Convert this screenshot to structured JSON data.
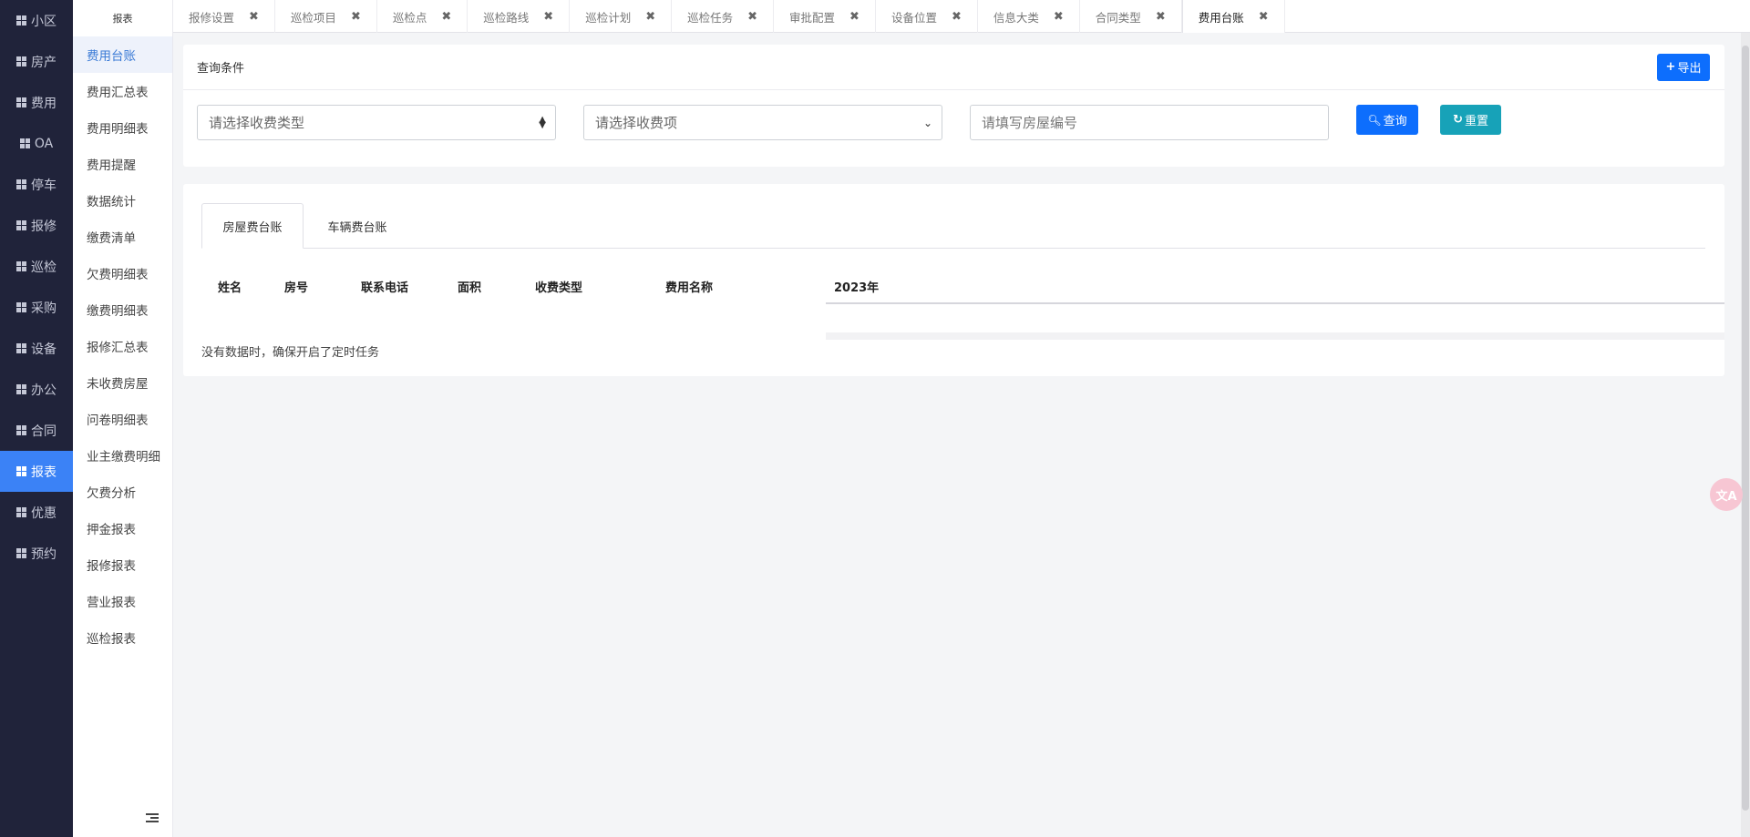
{
  "nav": {
    "items": [
      {
        "label": "小区",
        "icon": "grid-icon"
      },
      {
        "label": "房产",
        "icon": "grid-icon"
      },
      {
        "label": "费用",
        "icon": "grid-icon"
      },
      {
        "label": "OA",
        "icon": "grid-icon"
      },
      {
        "label": "停车",
        "icon": "grid-icon"
      },
      {
        "label": "报修",
        "icon": "grid-icon"
      },
      {
        "label": "巡检",
        "icon": "grid-icon"
      },
      {
        "label": "采购",
        "icon": "grid-icon"
      },
      {
        "label": "设备",
        "icon": "grid-icon"
      },
      {
        "label": "办公",
        "icon": "grid-icon"
      },
      {
        "label": "合同",
        "icon": "grid-icon"
      },
      {
        "label": "报表",
        "icon": "grid-icon"
      },
      {
        "label": "优惠",
        "icon": "grid-icon"
      },
      {
        "label": "预约",
        "icon": "grid-icon"
      }
    ],
    "active_index": 11,
    "active_color": "#3b82f6"
  },
  "subnav": {
    "title": "报表",
    "items": [
      "费用台账",
      "费用汇总表",
      "费用明细表",
      "费用提醒",
      "数据统计",
      "缴费清单",
      "欠费明细表",
      "缴费明细表",
      "报修汇总表",
      "未收费房屋",
      "问卷明细表",
      "业主缴费明细",
      "欠费分析",
      "押金报表",
      "报修报表",
      "营业报表",
      "巡检报表"
    ],
    "active_index": 0,
    "collapse_icon": "collapse-menu-icon"
  },
  "tabs": {
    "items": [
      "报修设置",
      "巡检项目",
      "巡检点",
      "巡检路线",
      "巡检计划",
      "巡检任务",
      "审批配置",
      "设备位置",
      "信息大类",
      "合同类型",
      "费用台账"
    ],
    "active_index": 10,
    "close_glyph": "✖"
  },
  "query": {
    "title": "查询条件",
    "export_label": "导出",
    "fee_type_placeholder": "请选择收费类型",
    "fee_item_placeholder": "请选择收费项",
    "house_no_placeholder": "请填写房屋编号",
    "search_label": "查询",
    "reset_label": "重置"
  },
  "ledger": {
    "tabs": [
      "房屋费台账",
      "车辆费台账"
    ],
    "active_tab": 0,
    "columns": [
      "姓名",
      "房号",
      "联系电话",
      "面积",
      "收费类型",
      "费用名称",
      "2023年"
    ],
    "rows": [],
    "empty_note": "没有数据时，确保开启了定时任务"
  },
  "colors": {
    "primary": "#0d6efd",
    "info": "#17a2b8",
    "nav_bg": "#20233a"
  }
}
